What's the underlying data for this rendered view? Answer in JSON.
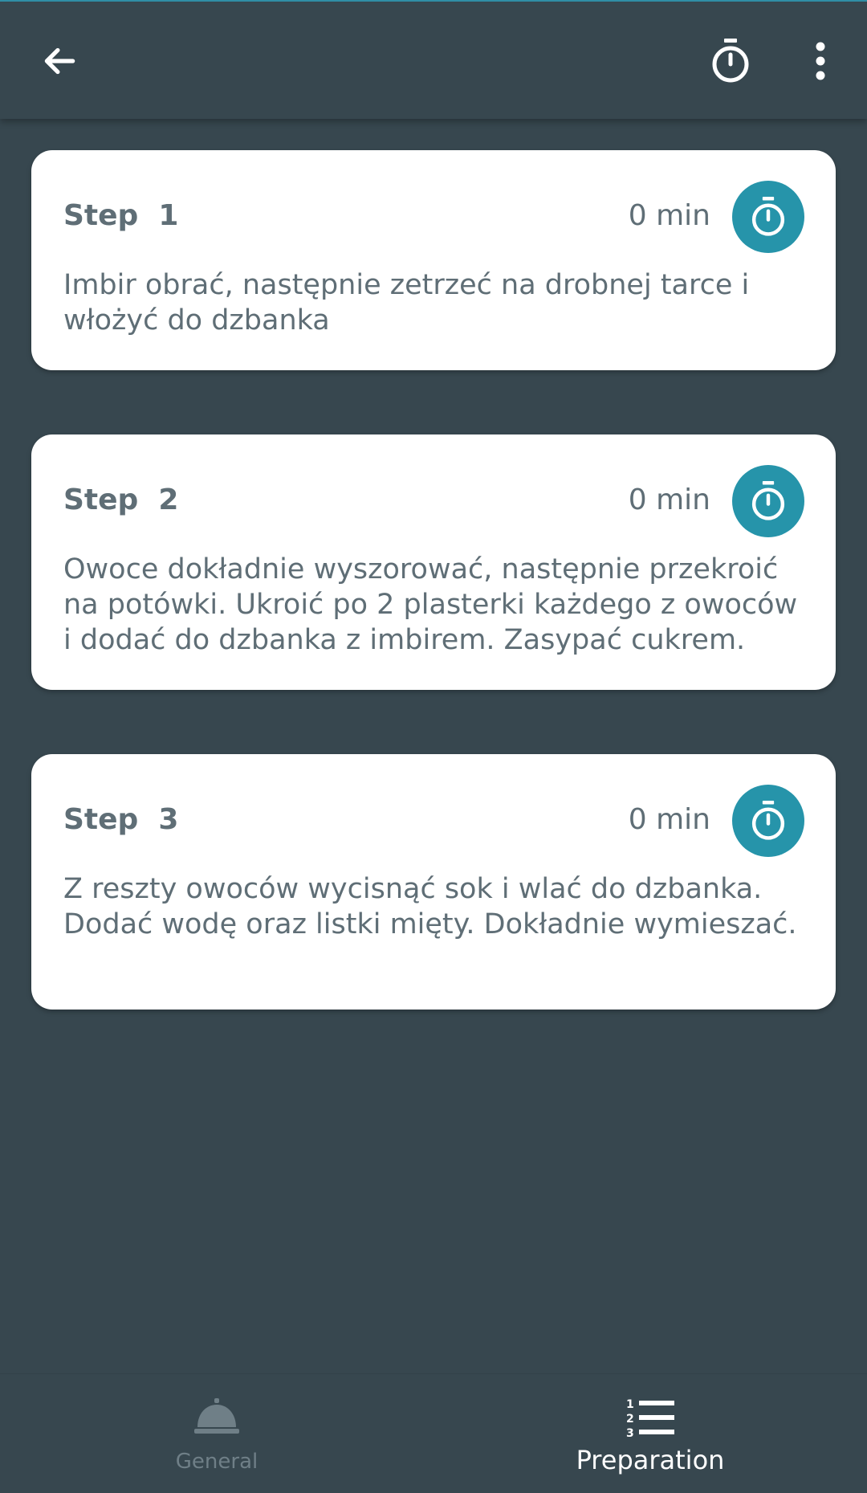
{
  "toolbar": {
    "back_icon": "arrow-left-icon",
    "timer_icon": "stopwatch-icon",
    "more_icon": "more-vertical-icon"
  },
  "steps": [
    {
      "title": "Step  1",
      "time": "0 min",
      "text": "Imbir obrać, następnie zetrzeć na drobnej tarce i włożyć do dzbanka",
      "timer_icon": "stopwatch-icon"
    },
    {
      "title": "Step  2",
      "time": "0 min",
      "text": "Owoce dokładnie wyszorować, następnie przekroić na potówki. Ukroić po 2 plasterki każdego z owoców i dodać do dzbanka z imbirem. Zasypać cukrem.",
      "timer_icon": "stopwatch-icon"
    },
    {
      "title": "Step  3",
      "time": "0 min",
      "text": "Z reszty owoców wycisnąć sok i wlać do dzbanka. Dodać wodę oraz listki mięty. Dokładnie wymieszać.",
      "timer_icon": "stopwatch-icon"
    }
  ],
  "bottom_nav": {
    "general_label": "General",
    "general_icon": "service-bell-icon",
    "preparation_label": "Preparation",
    "preparation_icon": "numbered-list-icon",
    "active": "Preparation"
  },
  "colors": {
    "background": "#37474f",
    "card": "#ffffff",
    "accent": "#2694aa",
    "text": "#5f6e76",
    "inactive_nav": "#6f7f87"
  }
}
